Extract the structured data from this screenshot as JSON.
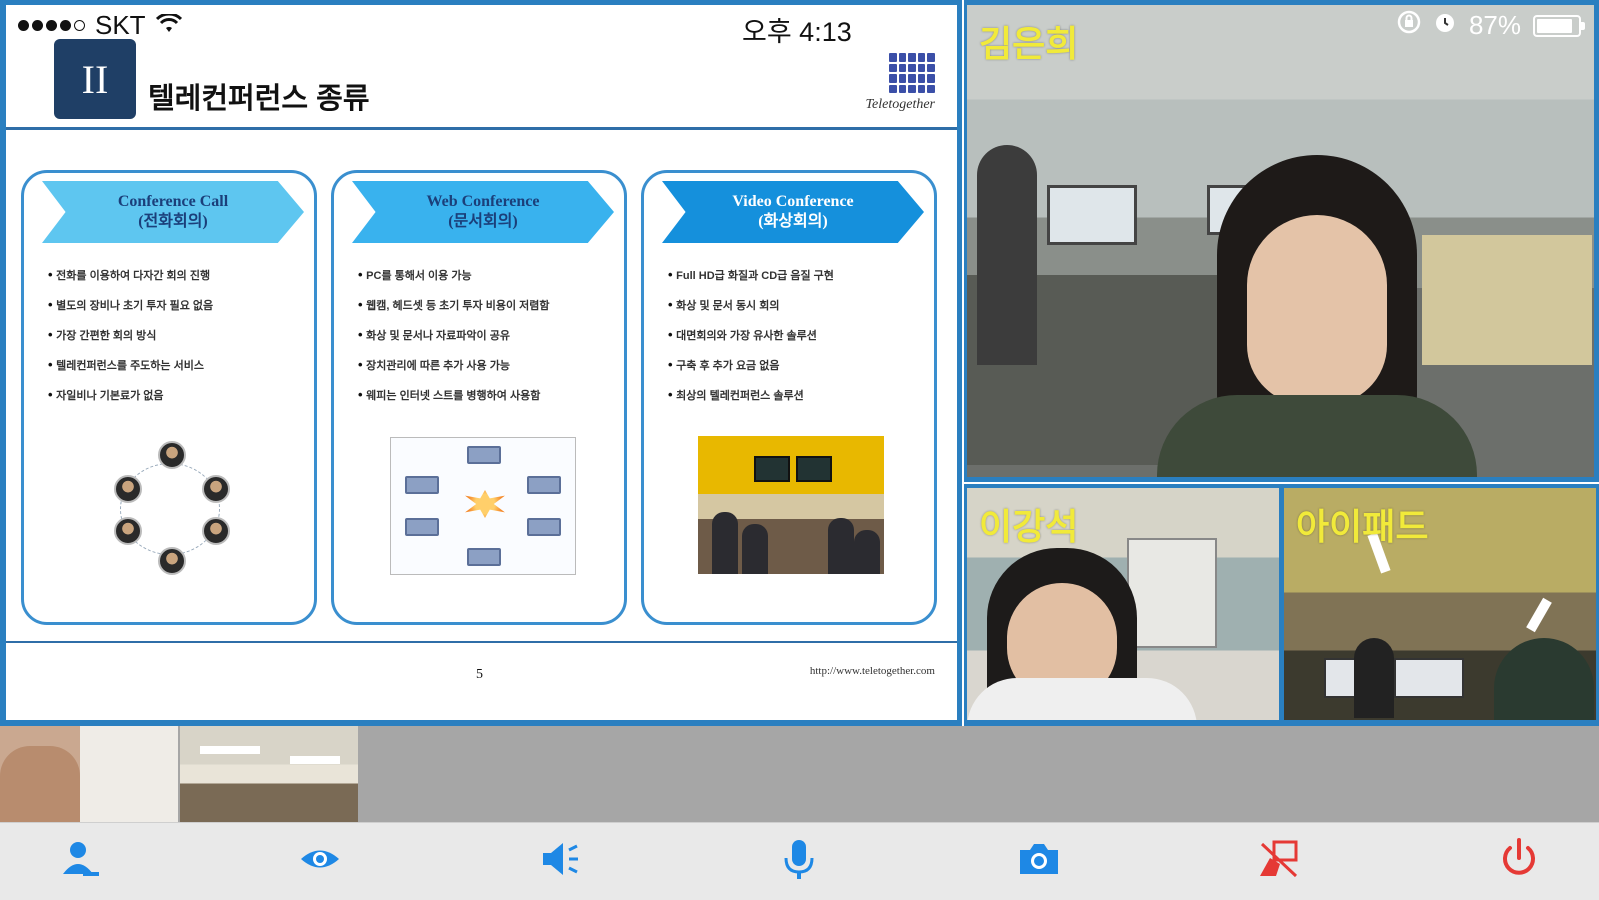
{
  "status_bar": {
    "carrier": "SKT",
    "time": "오후 4:13",
    "battery": "87%",
    "battery_level": 0.87,
    "icons": [
      "signal-dots-icon",
      "wifi-icon",
      "rotation-lock-icon",
      "alarm-icon",
      "battery-icon"
    ]
  },
  "slide": {
    "section_numeral": "II",
    "title": "텔레컨퍼런스 종류",
    "logo_text": "Teletogether",
    "page_number": "5",
    "footer_url": "http://www.teletogether.com",
    "cards": [
      {
        "title_en": "Conference Call",
        "title_ko": "(전화회의)",
        "bullets": [
          "전화를 이용하여 다자간 회의 진행",
          "별도의 장비나 초기 투자 필요 없음",
          "가장 간편한 회의 방식",
          "텔레컨퍼런스를 주도하는 서비스",
          "자일비나 기본료가 없음"
        ]
      },
      {
        "title_en": "Web Conference",
        "title_ko": "(문서회의)",
        "bullets": [
          "PC를 통해서 이용 가능",
          "웹캠, 헤드셋 등 초기 투자 비용이 저렴함",
          "화상 및 문서나 자료파악이 공유",
          "장치관리에 따른 추가 사용 가능",
          "웨피는 인터넷 스트를 병행하여 사용함"
        ]
      },
      {
        "title_en": "Video Conference",
        "title_ko": "(화상회의)",
        "bullets": [
          "Full HD급 화질과 CD급 음질 구현",
          "화상 및 문서 동시 회의",
          "대면회의와 가장 유사한 솔루션",
          "구축 후 추가 요금 없음",
          "최상의 텔레컨퍼런스 솔루션"
        ]
      }
    ]
  },
  "participants": {
    "main": "김은희",
    "tile_1": "이강석",
    "tile_2": "아이패드"
  },
  "toolbar": {
    "buttons": [
      {
        "name": "participants-icon"
      },
      {
        "name": "view-icon"
      },
      {
        "name": "speaker-icon"
      },
      {
        "name": "microphone-icon"
      },
      {
        "name": "camera-icon"
      },
      {
        "name": "stop-share-icon"
      },
      {
        "name": "power-icon"
      }
    ]
  },
  "colors": {
    "frame_blue": "#2a7fc0",
    "name_tag_yellow": "#f1ea3a",
    "toolbar_icon_blue": "#1e88e5",
    "toolbar_icon_red": "#e53935"
  }
}
